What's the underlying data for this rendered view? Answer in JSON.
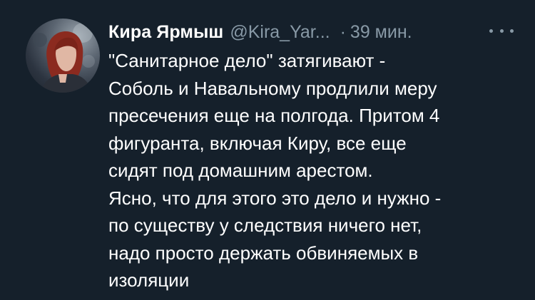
{
  "tweet": {
    "author_name": "Кира Ярмыш",
    "author_handle": "@Kira_Yar...",
    "separator": "·",
    "time": "39 мин.",
    "more_icon": "ellipsis-icon",
    "avatar_icon": "profile-photo",
    "lines": [
      "\"Санитарное дело\" затягивают -",
      "Соболь и Навальному продлили меру",
      "пресечения еще на полгода. Притом 4",
      "фигуранта, включая Киру, все еще",
      "сидят под домашним арестом.",
      "Ясно, что для этого это дело и нужно -",
      "по существу у следствия ничего нет,",
      "надо просто держать обвиняемых в",
      "изоляции"
    ]
  },
  "colors": {
    "background": "#15202b",
    "text": "#ffffff",
    "secondary": "#8899a6"
  }
}
